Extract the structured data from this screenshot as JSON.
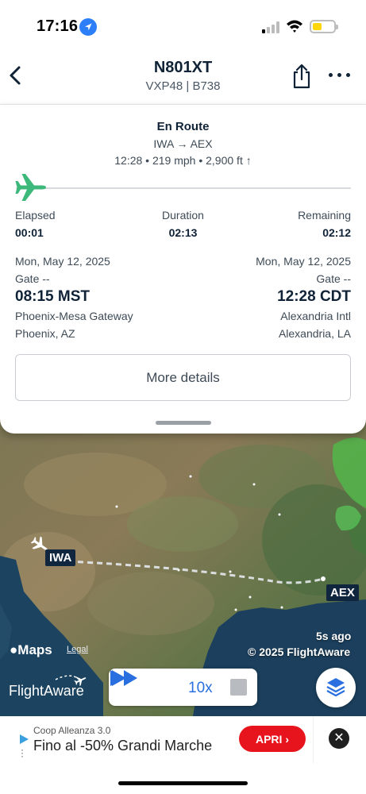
{
  "status_bar": {
    "time": "17:16"
  },
  "header": {
    "title": "N801XT",
    "subtitle": "VXP48 | B738"
  },
  "summary": {
    "status": "En Route",
    "route": "IWA → AEX",
    "stats": "12:28 • 219 mph • 2,900 ft ↑",
    "progress_fraction": 0.01,
    "elapsed_label": "Elapsed",
    "elapsed_value": "00:01",
    "duration_label": "Duration",
    "duration_value": "02:13",
    "remaining_label": "Remaining",
    "remaining_value": "02:12",
    "departure": {
      "date": "Mon, May 12, 2025",
      "gate": "Gate --",
      "time": "08:15 MST",
      "airport": "Phoenix-Mesa Gateway",
      "city": "Phoenix, AZ"
    },
    "arrival": {
      "date": "Mon, May 12, 2025",
      "gate": "Gate --",
      "time": "12:28 CDT",
      "airport": "Alexandria Intl",
      "city": "Alexandria, LA"
    },
    "more_details_label": "More details"
  },
  "map": {
    "origin_code": "IWA",
    "destination_code": "AEX",
    "updated": "5s ago",
    "copyright": "© 2025 FlightAware",
    "maps_brand": "Maps",
    "legal": "Legal",
    "flightaware_logo": "FlightAware",
    "playback_speed": "10x",
    "icons": [
      "play-icon",
      "fast-forward-icon",
      "stop-icon",
      "layers-icon"
    ]
  },
  "ad": {
    "brand": "Coop Alleanza 3.0",
    "headline": "Fino al -50% Grandi Marche",
    "cta": "APRI"
  },
  "colors": {
    "accent": "#2a6fe0",
    "plane": "#3cb87a",
    "ad_cta": "#e8141d",
    "tag_bg": "#10263f"
  }
}
